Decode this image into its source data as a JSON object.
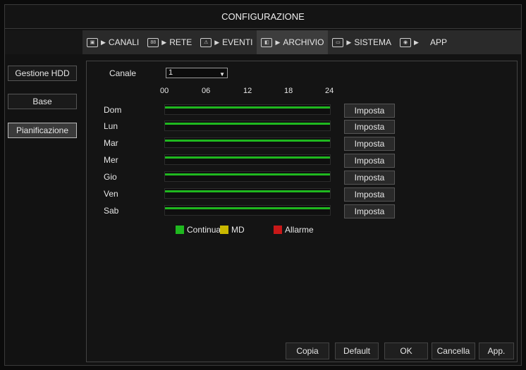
{
  "window": {
    "title": "CONFIGURAZIONE"
  },
  "tabs": [
    {
      "label": "CANALI",
      "icon": "camera-icon",
      "active": false
    },
    {
      "label": "RETE",
      "icon": "network-icon",
      "active": false
    },
    {
      "label": "EVENTI",
      "icon": "alert-icon",
      "active": false
    },
    {
      "label": "ARCHIVIO",
      "icon": "archive-icon",
      "active": true
    },
    {
      "label": "SISTEMA",
      "icon": "monitor-icon",
      "active": false
    },
    {
      "label": "APP",
      "icon": "app-icon",
      "active": false
    }
  ],
  "sidebar": {
    "items": [
      {
        "label": "Gestione HDD",
        "active": false
      },
      {
        "label": "Base",
        "active": false
      },
      {
        "label": "Pianificazione",
        "active": true
      }
    ]
  },
  "schedule": {
    "channel_label": "Canale",
    "channel_value": "1",
    "hours": [
      "00",
      "06",
      "12",
      "18",
      "24"
    ],
    "days": [
      {
        "label": "Dom",
        "button": "Imposta",
        "continua": 1.0
      },
      {
        "label": "Lun",
        "button": "Imposta",
        "continua": 1.0
      },
      {
        "label": "Mar",
        "button": "Imposta",
        "continua": 1.0
      },
      {
        "label": "Mer",
        "button": "Imposta",
        "continua": 1.0
      },
      {
        "label": "Gio",
        "button": "Imposta",
        "continua": 1.0
      },
      {
        "label": "Ven",
        "button": "Imposta",
        "continua": 1.0
      },
      {
        "label": "Sab",
        "button": "Imposta",
        "continua": 1.0
      }
    ],
    "legend": [
      {
        "label": "Continua",
        "color": "#1fb81f"
      },
      {
        "label": "MD",
        "color": "#c9b800"
      },
      {
        "label": "Allarme",
        "color": "#c81818"
      }
    ]
  },
  "footer": {
    "copia": "Copia",
    "default": "Default",
    "ok": "OK",
    "cancella": "Cancella",
    "app": "App."
  },
  "colors": {
    "continua": "#1fb81f"
  }
}
